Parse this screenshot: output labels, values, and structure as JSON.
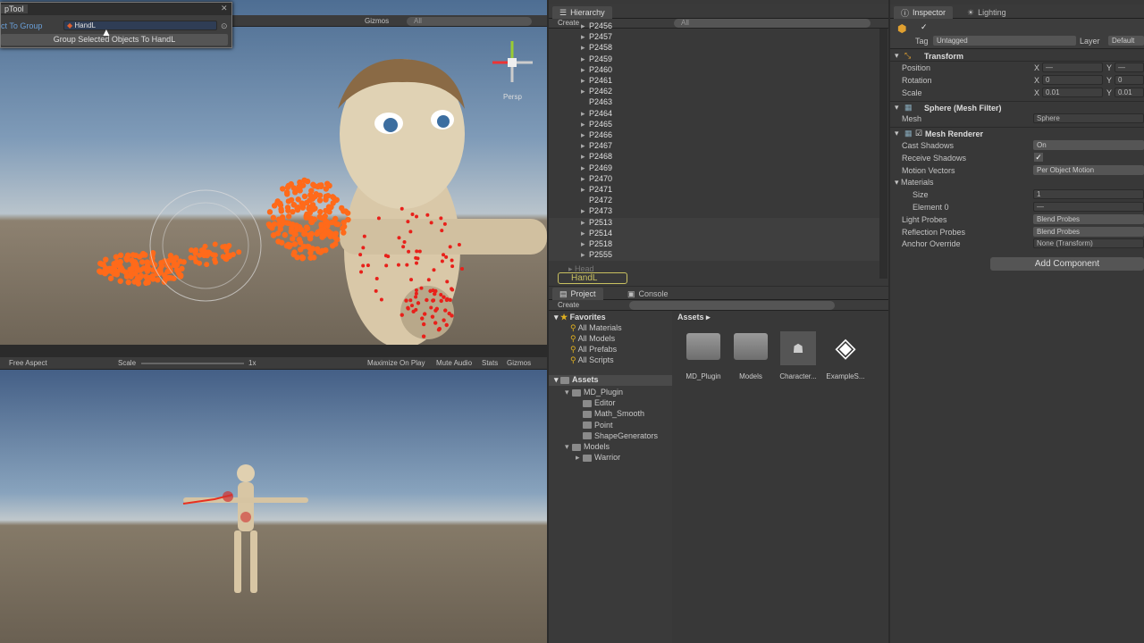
{
  "tool_window": {
    "title": "pTool",
    "row_label": "ct To Group",
    "field_value": "HandL",
    "button_label": "Group Selected Objects To HandL"
  },
  "scene": {
    "gizmos_label": "Gizmos",
    "search_all": "All",
    "persp_label": "Persp"
  },
  "game": {
    "aspect": "Free Aspect",
    "scale_label": "Scale",
    "scale_value": "1x",
    "maximize": "Maximize On Play",
    "mute": "Mute Audio",
    "stats": "Stats",
    "gizmos": "Gizmos"
  },
  "hierarchy": {
    "tab": "Hierarchy",
    "create": "Create",
    "search_all": "All",
    "items": [
      "P2456",
      "P2457",
      "P2458",
      "P2459",
      "P2460",
      "P2461",
      "P2462",
      "P2463",
      "P2464",
      "P2465",
      "P2466",
      "P2467",
      "P2468",
      "P2469",
      "P2470",
      "P2471",
      "P2472",
      "P2473",
      "P2513",
      "P2514",
      "P2518",
      "P2555"
    ],
    "collapsed_item": "Head",
    "selected_item": "HandL"
  },
  "project": {
    "tab_project": "Project",
    "tab_console": "Console",
    "create": "Create",
    "favorites_label": "Favorites",
    "favorites": [
      "All Materials",
      "All Models",
      "All Prefabs",
      "All Scripts"
    ],
    "assets_label": "Assets",
    "tree": [
      "MD_Plugin",
      "Editor",
      "Math_Smooth",
      "Point",
      "ShapeGenerators",
      "Models",
      "Warrior"
    ],
    "breadcrumb": "Assets",
    "grid_items": [
      "MD_Plugin",
      "Models",
      "Character...",
      "ExampleS..."
    ]
  },
  "inspector": {
    "tab": "Inspector",
    "tab_lighting": "Lighting",
    "tag_label": "Tag",
    "tag_value": "Untagged",
    "layer_label": "Layer",
    "layer_value": "Default",
    "transform_title": "Transform",
    "position_label": "Position",
    "rotation_label": "Rotation",
    "scale_label": "Scale",
    "x": "X",
    "y": "Y",
    "pos_x": "—",
    "pos_y": "—",
    "rot_x": "0",
    "rot_y": "0",
    "scale_x": "0.01",
    "scale_y": "0.01",
    "meshfilter_title": "Sphere (Mesh Filter)",
    "mesh_label": "Mesh",
    "mesh_value": "Sphere",
    "meshrenderer_title": "Mesh Renderer",
    "cast_shadows_label": "Cast Shadows",
    "cast_shadows_value": "On",
    "receive_shadows_label": "Receive Shadows",
    "receive_check": "✓",
    "motion_vectors_label": "Motion Vectors",
    "motion_vectors_value": "Per Object Motion",
    "materials_label": "Materials",
    "size_label": "Size",
    "size_value": "1",
    "element0_label": "Element 0",
    "element0_value": "—",
    "light_probes_label": "Light Probes",
    "light_probes_value": "Blend Probes",
    "reflection_probes_label": "Reflection Probes",
    "reflection_probes_value": "Blend Probes",
    "anchor_label": "Anchor Override",
    "anchor_value": "None (Transform)",
    "add_component": "Add Component"
  },
  "colors": {
    "accent": "#3d6aa8",
    "selected_outline": "#c8c060",
    "point_orange": "#ff6a1a",
    "point_red": "#e8201a"
  }
}
